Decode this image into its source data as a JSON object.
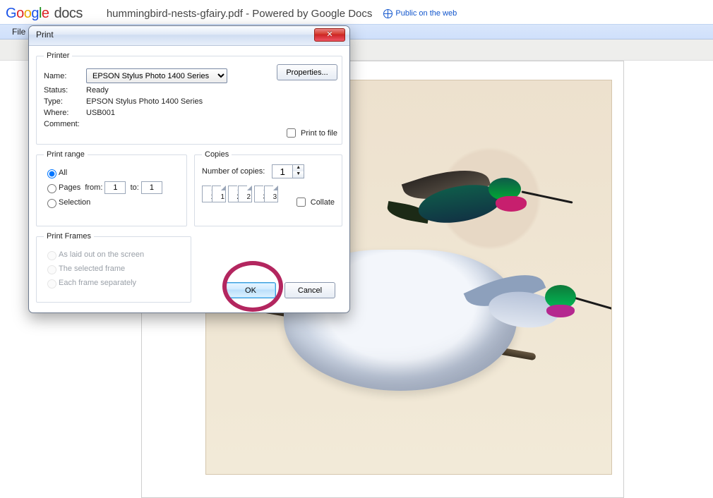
{
  "logo_docs": "docs",
  "doc_title": "hummingbird-nests-gfairy.pdf - Powered by Google Docs",
  "public_label": "Public on the web",
  "menu": {
    "file": "File"
  },
  "dialog": {
    "title": "Print",
    "close_x": "✕",
    "printer": {
      "legend": "Printer",
      "name_label": "Name:",
      "name_value": "EPSON Stylus Photo 1400 Series",
      "properties_btn": "Properties...",
      "status_label": "Status:",
      "status_value": "Ready",
      "type_label": "Type:",
      "type_value": "EPSON Stylus Photo 1400 Series",
      "where_label": "Where:",
      "where_value": "USB001",
      "comment_label": "Comment:",
      "print_to_file": "Print to file"
    },
    "range": {
      "legend": "Print range",
      "all": "All",
      "pages": "Pages",
      "from_label": "from:",
      "from_value": "1",
      "to_label": "to:",
      "to_value": "1",
      "selection": "Selection"
    },
    "copies": {
      "legend": "Copies",
      "num_label": "Number of copies:",
      "num_value": "1",
      "collate": "Collate",
      "p1": "1",
      "p2": "2",
      "p3": "3"
    },
    "frames": {
      "legend": "Print Frames",
      "as_laid": "As laid out on the screen",
      "selected": "The selected frame",
      "each": "Each frame separately"
    },
    "ok": "OK",
    "cancel": "Cancel"
  }
}
